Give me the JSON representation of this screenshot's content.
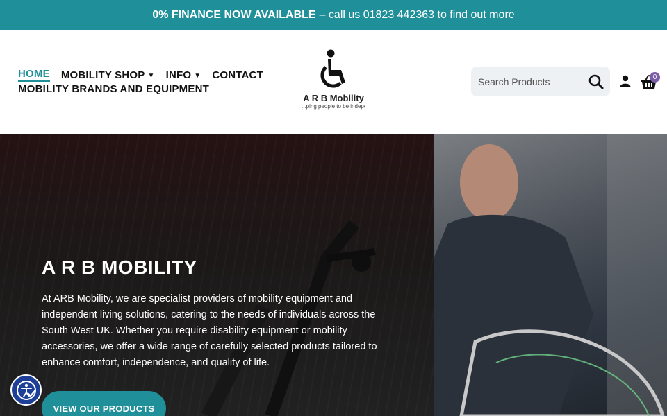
{
  "announcement": {
    "highlight": "0% FINANCE NOW AVAILABLE",
    "text": "– call us 01823 442363 to find out more"
  },
  "nav": {
    "items": [
      {
        "label": "HOME",
        "active": true
      },
      {
        "label": "MOBILITY SHOP",
        "dropdown": true
      },
      {
        "label": "INFO",
        "dropdown": true
      },
      {
        "label": "CONTACT"
      },
      {
        "label": "MOBILITY BRANDS AND EQUIPMENT"
      }
    ]
  },
  "logo": {
    "name": "A R B Mobility",
    "tagline": "...ping people to be indepen..."
  },
  "search": {
    "placeholder": "Search Products"
  },
  "basket": {
    "count": "0"
  },
  "hero": {
    "title": "A R B MOBILITY",
    "text": "At ARB Mobility, we are specialist providers of mobility equipment and independent living solutions, catering to the needs of individuals across the South West UK. Whether you require disability equipment or mobility accessories, we offer a wide range of carefully selected products tailored to enhance comfort, independence, and quality of life.",
    "button": "VIEW OUR PRODUCTS"
  },
  "colors": {
    "accent": "#1f8f99",
    "badge": "#7b5ea7",
    "a11y": "#1d3f98"
  },
  "icons": [
    "wheelchair-logo-icon",
    "search-icon",
    "user-icon",
    "basket-icon",
    "accessibility-icon"
  ]
}
